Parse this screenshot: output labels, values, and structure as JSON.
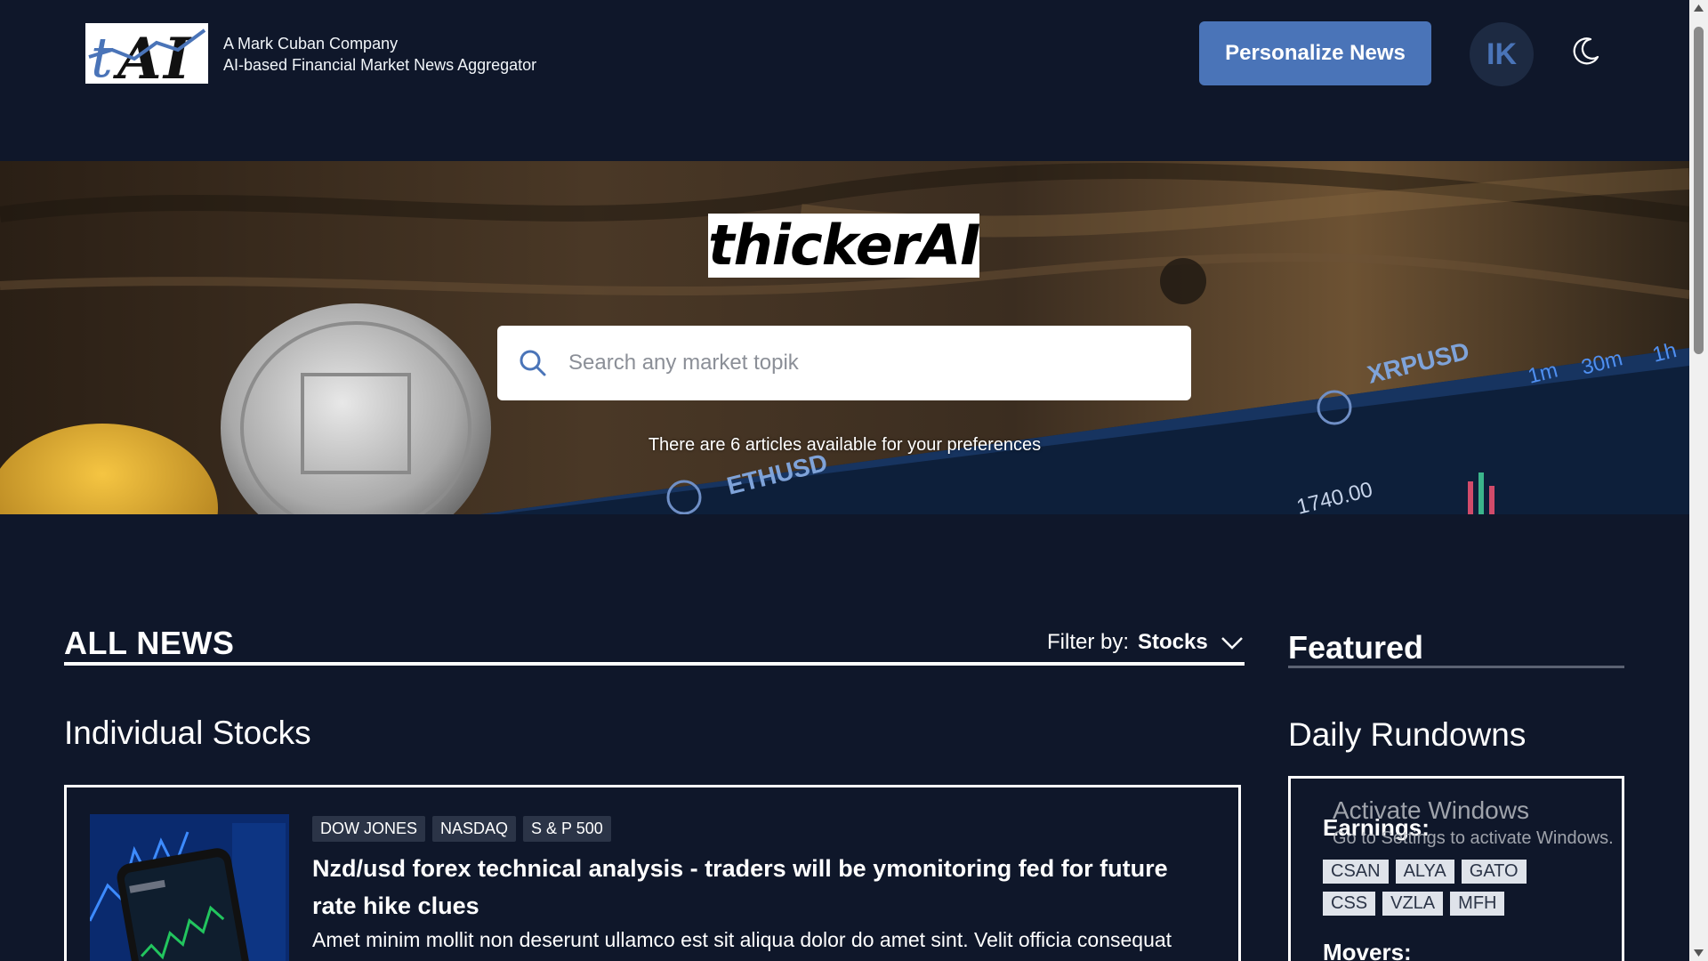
{
  "header": {
    "tagline_line1": "A Mark Cuban Company",
    "tagline_line2": "AI-based Financial Market News Aggregator",
    "personalize_label": "Personalize News",
    "avatar_initials": "IK",
    "theme_icon": "moon-icon"
  },
  "hero": {
    "brand": "thickerAI",
    "search_placeholder": "Search any market topik",
    "articles_text": "There are 6 articles available for your preferences",
    "chart_labels": {
      "pair1": "XRPUSD",
      "pair2": "ETHUSD",
      "t1": "1m",
      "t2": "30m",
      "t3": "1h",
      "price": "1740.00"
    }
  },
  "all_news": {
    "title": "ALL NEWS",
    "filter_label": "Filter by:",
    "filter_value": "Stocks"
  },
  "section": {
    "title": "Individual Stocks"
  },
  "article": {
    "tags": [
      "DOW JONES",
      "NASDAQ",
      "S & P 500"
    ],
    "headline": "Nzd/usd forex technical analysis - traders will be ymonitoring fed for future rate hike clues",
    "excerpt": "Amet minim mollit non deserunt ullamco est sit aliqua dolor do amet sint. Velit officia consequat"
  },
  "featured": {
    "title": "Featured",
    "rundowns_title": "Daily Rundowns",
    "earnings_label": "Earnings:",
    "earnings_tags_row1": [
      "CSAN",
      "ALYA",
      "GATO"
    ],
    "earnings_tags_row2": [
      "CSS",
      "VZLA",
      "MFH"
    ],
    "movers_label": "Movers:"
  },
  "watermark": {
    "line1": "Activate Windows",
    "line2": "Go to Settings to activate Windows."
  },
  "colors": {
    "background": "#0f172a",
    "accent_button": "#4a74b8",
    "avatar_bg": "#1d2a42",
    "tag_bg": "#2b3447"
  }
}
